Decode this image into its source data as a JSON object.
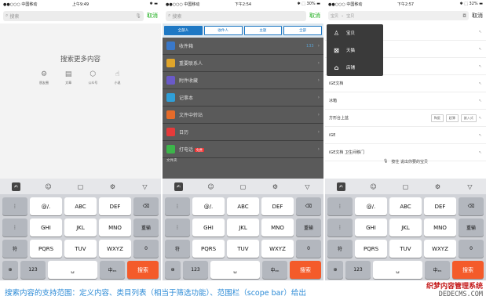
{
  "screens": [
    {
      "status": {
        "carrier": "●●○○○ 中国移动 ",
        "time": "上午9:49",
        "right": "✱ ▬"
      },
      "search": {
        "placeholder": "搜索",
        "cancel": "取消"
      },
      "empty_title": "搜索更多内容",
      "categories": [
        {
          "icon": "gear-icon",
          "label": "朋友圈"
        },
        {
          "icon": "doc-icon",
          "label": "文章"
        },
        {
          "icon": "cube-icon",
          "label": "公众号"
        },
        {
          "icon": "hand-icon",
          "label": "小说"
        }
      ]
    },
    {
      "status": {
        "carrier": "●●○○○ 中国移动 ",
        "time": "下午2:54",
        "right": "✱ ⬚ 30% ▬"
      },
      "search": {
        "placeholder": "搜索",
        "cancel": "取消"
      },
      "scopes": [
        "全部人",
        "收件人",
        "主题",
        "全部"
      ],
      "folders": [
        {
          "label": "收件箱",
          "count": "133",
          "color": "#3a78c9"
        },
        {
          "label": "重要联系人",
          "count": "",
          "color": "#e0a52a"
        },
        {
          "label": "附件收藏",
          "count": "",
          "color": "#6a5ac8"
        },
        {
          "label": "记事本",
          "count": "",
          "color": "#2f9fd8"
        },
        {
          "label": "文件中转站",
          "count": "",
          "color": "#e66b2a"
        },
        {
          "label": "日历",
          "count": "",
          "color": "#e63a3a"
        },
        {
          "label": "打电话",
          "count": "",
          "color": "#3cb54a",
          "tag": "免费"
        }
      ],
      "section": "文件夹"
    },
    {
      "status": {
        "carrier": "●●○○○ 中国移动 ",
        "time": "下午2:57",
        "right": "✱ ⬚ 32% ▬"
      },
      "search": {
        "scope": "宝贝",
        "placeholder": "宝贝",
        "cancel": "取消"
      },
      "popup": [
        "宝贝",
        "天猫",
        "店铺"
      ],
      "results": [
        {
          "text": "",
          "chips": []
        },
        {
          "text": "",
          "chips": []
        },
        {
          "text": "",
          "chips": []
        },
        {
          "text": "iGE文档",
          "chips": []
        },
        {
          "text": "冰箱",
          "chips": []
        },
        {
          "text": "方形台上盆",
          "chips": [
            "陶瓷",
            "超薄",
            "嵌入式"
          ]
        },
        {
          "text": "iGE",
          "chips": []
        },
        {
          "text": "iGE文档 卫生间移门",
          "chips": []
        }
      ],
      "voice_hint": "按住 说出你要的宝贝"
    }
  ],
  "keyboard": {
    "rows": [
      [
        "@/.",
        "ABC",
        "DEF"
      ],
      [
        "GHI",
        "JKL",
        "MNO"
      ],
      [
        "PQRS",
        "TUV",
        "WXYZ"
      ]
    ],
    "left_keys": [
      "⋮",
      "⋮",
      "符"
    ],
    "right_keys": [
      "⌫",
      "重输",
      "0"
    ],
    "bottom": {
      "globe": "⊕",
      "num": "123",
      "space": "␣",
      "cn": "中ₑₙ",
      "go": "搜索"
    },
    "toolbar": [
      "✍",
      "☺",
      "▢",
      "⚙",
      "▽"
    ]
  },
  "caption": "搜索内容的支持范围：定义内容、类目列表（相当于筛选功能）、范围栏（scope bar）给出",
  "watermark": {
    "line1": "织梦内容管理系统",
    "line2": "DEDECMS.COM"
  }
}
